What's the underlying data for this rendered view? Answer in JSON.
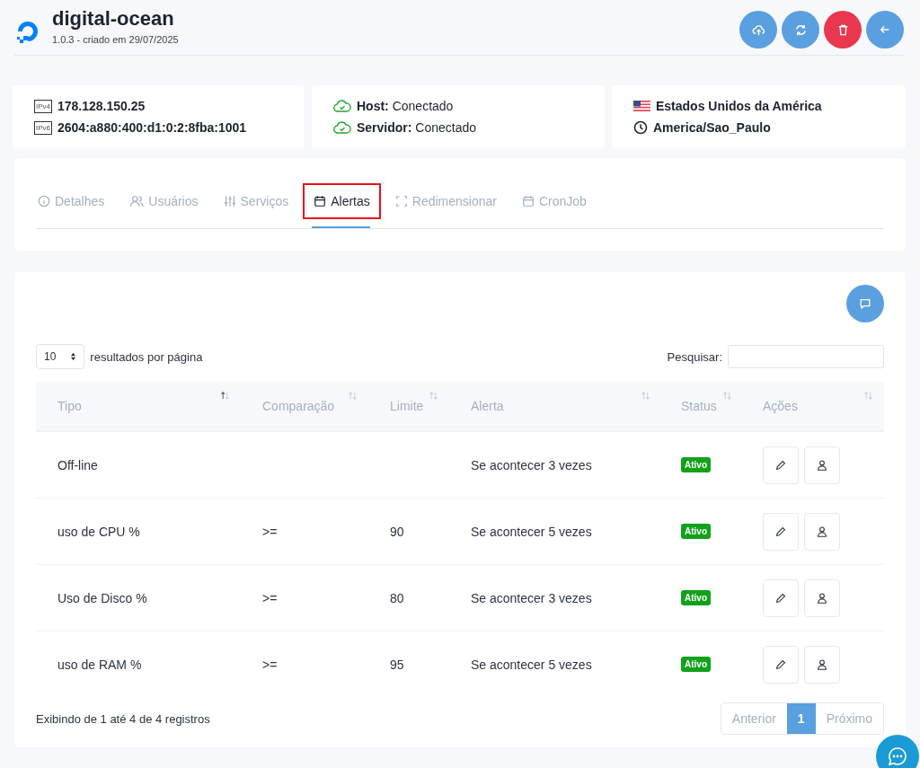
{
  "header": {
    "title": "digital-ocean",
    "subtitle": "1.0.3 - criado em 29/07/2025",
    "actions": [
      {
        "kind": "upload",
        "danger": false
      },
      {
        "kind": "refresh",
        "danger": false
      },
      {
        "kind": "delete",
        "danger": true
      },
      {
        "kind": "back",
        "danger": false
      }
    ]
  },
  "info": {
    "ipv4_label": "IPv4",
    "ipv4": "178.128.150.25",
    "ipv6_label": "IPv6",
    "ipv6": "2604:a880:400:d1:0:2:8fba:1001",
    "connections": [
      {
        "label": "Host:",
        "value": "Conectado",
        "ok": true
      },
      {
        "label": "Servidor:",
        "value": "Conectado",
        "ok": true
      }
    ],
    "country": "Estados Unidos da América",
    "timezone": "America/Sao_Paulo"
  },
  "tabs": [
    {
      "label": "Detalhes",
      "kind": "info",
      "selected": false,
      "highlighted": false
    },
    {
      "label": "Usuários",
      "kind": "users",
      "selected": false,
      "highlighted": false
    },
    {
      "label": "Serviços",
      "kind": "sliders",
      "selected": false,
      "highlighted": false
    },
    {
      "label": "Alertas",
      "kind": "calendar",
      "selected": true,
      "highlighted": true
    },
    {
      "label": "Redimensionar",
      "kind": "resize",
      "selected": false,
      "highlighted": false
    },
    {
      "label": "CronJob",
      "kind": "calendar",
      "selected": false,
      "highlighted": false
    }
  ],
  "table": {
    "page_size": "10",
    "page_size_label": "resultados por página",
    "search_label": "Pesquisar:",
    "columns": [
      {
        "label": "Tipo",
        "sorted": true
      },
      {
        "label": "Comparação",
        "sorted": false
      },
      {
        "label": "Limite",
        "sorted": false
      },
      {
        "label": "Alerta",
        "sorted": false
      },
      {
        "label": "Status",
        "sorted": false
      },
      {
        "label": "Ações",
        "sorted": false
      }
    ],
    "rows": [
      {
        "tipo": "Off-line",
        "alerta": "Se acontecer 3 vezes",
        "status": "Ativo"
      },
      {
        "tipo": "uso de CPU %",
        "comparacao": ">=",
        "limite": "90",
        "alerta": "Se acontecer 5 vezes",
        "status": "Ativo"
      },
      {
        "tipo": "Uso de Disco %",
        "comparacao": ">=",
        "limite": "80",
        "alerta": "Se acontecer 3 vezes",
        "status": "Ativo"
      },
      {
        "tipo": "uso de RAM %",
        "comparacao": ">=",
        "limite": "95",
        "alerta": "Se acontecer 5 vezes",
        "status": "Ativo"
      }
    ],
    "summary": "Exibindo de 1 até 4 de 4 registros",
    "pagination": [
      {
        "label": "Anterior",
        "selected": false
      },
      {
        "label": "1",
        "selected": true
      },
      {
        "label": "Próximo",
        "selected": false
      }
    ]
  }
}
